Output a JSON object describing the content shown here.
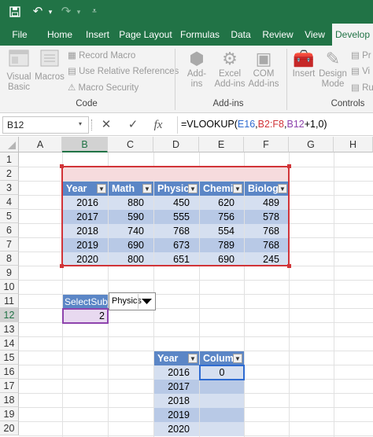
{
  "quick_access": {
    "save_icon": "save-icon",
    "undo_icon": "undo-icon",
    "redo_icon": "redo-icon",
    "customize_icon": "customize-icon"
  },
  "tabs": [
    "File",
    "Home",
    "Insert",
    "Page Layout",
    "Formulas",
    "Data",
    "Review",
    "View",
    "Develop"
  ],
  "ribbon": {
    "code": {
      "visual_basic": [
        "Visual",
        "Basic"
      ],
      "macros": "Macros",
      "record_macro": "Record Macro",
      "relative_refs": "Use Relative References",
      "macro_security": "Macro Security",
      "label": "Code"
    },
    "addins": {
      "addins": [
        "Add-",
        "ins"
      ],
      "excel_addins": [
        "Excel",
        "Add-ins"
      ],
      "com_addins": [
        "COM",
        "Add-ins"
      ],
      "label": "Add-ins"
    },
    "controls": {
      "insert": "Insert",
      "design_mode": [
        "Design",
        "Mode"
      ],
      "properties": "Pr",
      "view_code": "Vi",
      "run_dialog": "Ru",
      "label": "Controls"
    }
  },
  "formula_bar": {
    "name_box": "B12",
    "cancel": "✕",
    "enter": "✓",
    "fx": "fx",
    "formula_parts": [
      "=VLOOKUP(",
      "E16",
      ",",
      "B2:F8",
      ",",
      "B12",
      "+1,0)"
    ]
  },
  "grid": {
    "columns": [
      "A",
      "B",
      "C",
      "D",
      "E",
      "F",
      "G",
      "H"
    ],
    "rows": [
      "1",
      "2",
      "3",
      "4",
      "5",
      "6",
      "7",
      "8",
      "9",
      "10",
      "11",
      "12",
      "13",
      "14",
      "15",
      "16",
      "17",
      "18",
      "19",
      "20"
    ]
  },
  "table1": {
    "headers": [
      "Year",
      "Math",
      "Physic",
      "Chemis",
      "Biolog"
    ],
    "rows": [
      [
        "2016",
        "880",
        "450",
        "620",
        "489"
      ],
      [
        "2017",
        "590",
        "555",
        "756",
        "578"
      ],
      [
        "2018",
        "740",
        "768",
        "554",
        "768"
      ],
      [
        "2019",
        "690",
        "673",
        "789",
        "768"
      ],
      [
        "2020",
        "800",
        "651",
        "690",
        "245"
      ]
    ]
  },
  "select_subject": {
    "label": "SelectSubj.",
    "value": "2",
    "dropdown_value": "Physics"
  },
  "table2": {
    "headers": [
      "Year",
      "Colum"
    ],
    "rows": [
      [
        "2016",
        "0"
      ],
      [
        "2017",
        ""
      ],
      [
        "2018",
        ""
      ],
      [
        "2019",
        ""
      ],
      [
        "2020",
        ""
      ]
    ]
  },
  "colors": {
    "excel_green": "#217346",
    "table_header": "#5b86c6",
    "ref_red": "#d13438",
    "ref_purple": "#8e44ad",
    "ref_blue": "#2e6bd1"
  }
}
